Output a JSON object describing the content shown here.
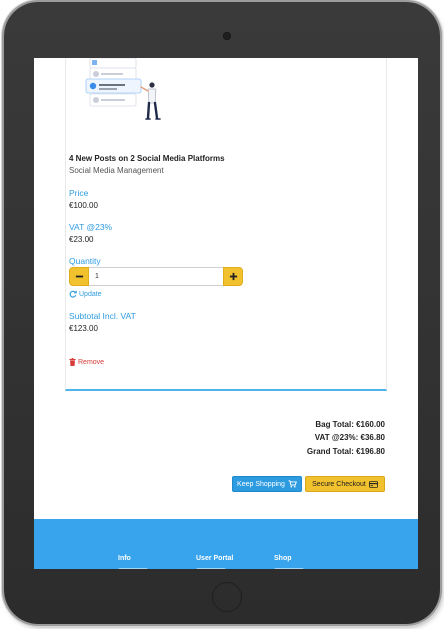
{
  "product": {
    "name": "4 New Posts on 2 Social Media Platforms",
    "category": "Social Media Management",
    "price_label": "Price",
    "price_value": "€100.00",
    "vat_label": "VAT @23%",
    "vat_value": "€23.00",
    "quantity_label": "Quantity",
    "quantity_value": "1",
    "update_label": "Update",
    "subtotal_label": "Subtotal Incl. VAT",
    "subtotal_value": "€123.00",
    "remove_label": "Remove"
  },
  "totals": {
    "bag_total": "Bag Total: €160.00",
    "vat_total": "VAT @23%: €36.80",
    "grand_total": "Grand Total: €196.80"
  },
  "actions": {
    "keep_shopping": "Keep Shopping",
    "secure_checkout": "Secure Checkout"
  },
  "footer": {
    "col1_title": "Info",
    "col2_title": "User Portal",
    "col3_title": "Shop"
  },
  "icons": {
    "minus": "minus-icon",
    "plus": "plus-icon",
    "refresh": "refresh-icon",
    "trash": "trash-icon",
    "cart": "cart-icon",
    "card": "credit-card-icon"
  },
  "colors": {
    "accent_blue": "#2d9be0",
    "accent_yellow": "#f2c12e",
    "footer_blue": "#38a4ee",
    "danger_red": "#d73a3a"
  }
}
